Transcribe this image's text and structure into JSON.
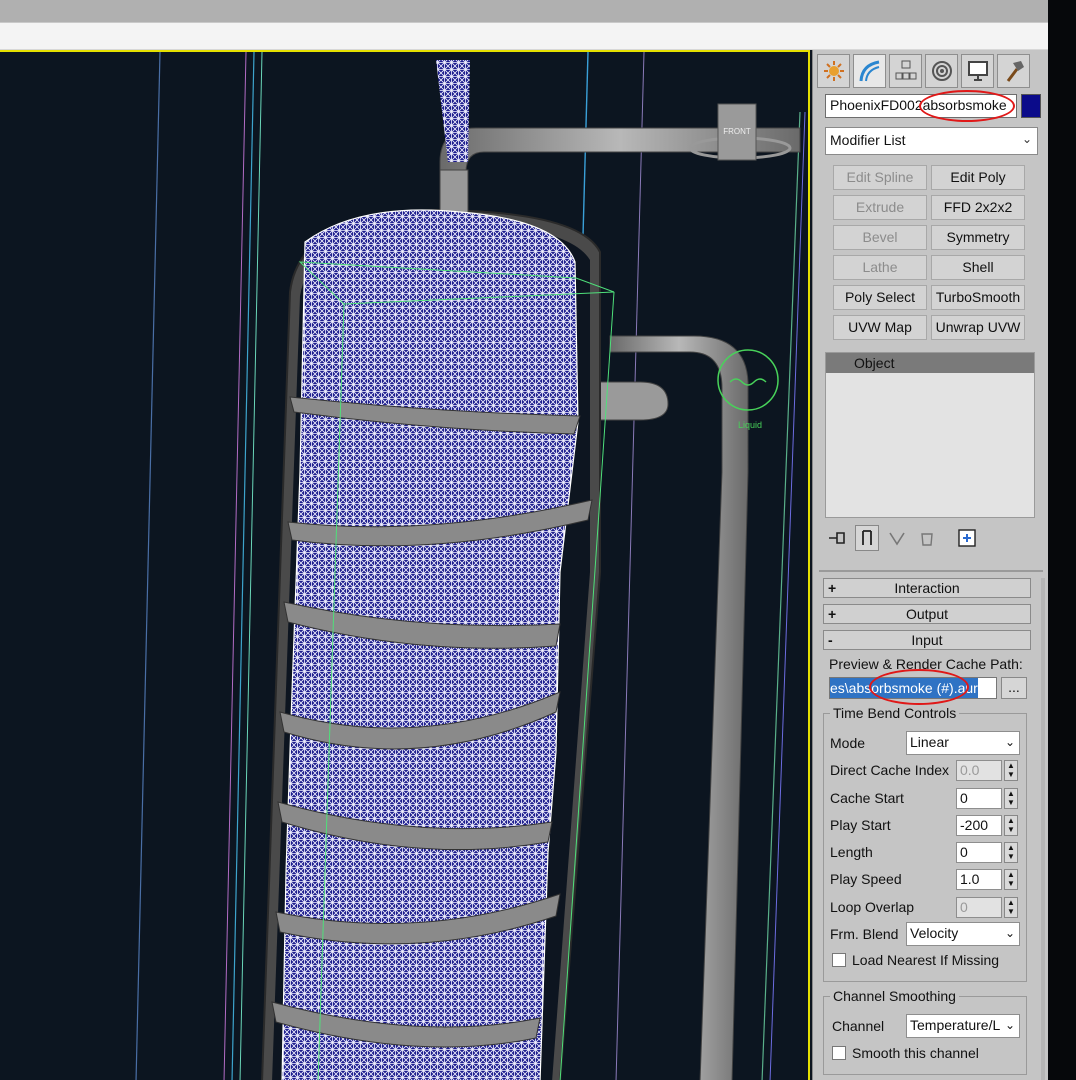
{
  "command_panel": {
    "tabs": [
      {
        "name": "create-tab",
        "icon": "sun-star-icon"
      },
      {
        "name": "modify-tab",
        "icon": "modify-curve-icon"
      },
      {
        "name": "hierarchy-tab",
        "icon": "hierarchy-icon"
      },
      {
        "name": "motion-tab",
        "icon": "motion-icon"
      },
      {
        "name": "display-tab",
        "icon": "display-monitor-icon"
      },
      {
        "name": "utilities-tab",
        "icon": "hammer-icon"
      }
    ],
    "object_name": "PhoenixFD002absorbsmoke",
    "object_color": "#0b0b8a",
    "modifier_list": "Modifier List",
    "modifier_buttons": [
      {
        "label": "Edit Spline",
        "enabled": false
      },
      {
        "label": "Edit Poly",
        "enabled": true
      },
      {
        "label": "Extrude",
        "enabled": false
      },
      {
        "label": "FFD 2x2x2",
        "enabled": true
      },
      {
        "label": "Bevel",
        "enabled": false
      },
      {
        "label": "Symmetry",
        "enabled": true
      },
      {
        "label": "Lathe",
        "enabled": false
      },
      {
        "label": "Shell",
        "enabled": true
      },
      {
        "label": "Poly Select",
        "enabled": true
      },
      {
        "label": "TurboSmooth",
        "enabled": true
      },
      {
        "label": "UVW Map",
        "enabled": true
      },
      {
        "label": "Unwrap UVW",
        "enabled": true
      }
    ],
    "stack_item": "Object",
    "stack_tools": [
      "pin-stack-icon",
      "show-end-result-icon",
      "make-unique-icon",
      "remove-modifier-icon",
      "configure-sets-icon"
    ]
  },
  "rollouts": {
    "interaction": {
      "sign": "+",
      "label": "Interaction"
    },
    "output": {
      "sign": "+",
      "label": "Output"
    },
    "input": {
      "sign": "-",
      "label": "Input"
    },
    "cache_path_label": "Preview & Render Cache Path:",
    "cache_path_value": "es\\absorbsmoke (#).aur",
    "browse_label": "...",
    "time_bend": {
      "title": "Time Bend Controls",
      "mode_label": "Mode",
      "mode_value": "Linear",
      "direct_cache_index_label": "Direct Cache Index",
      "direct_cache_index_value": "0.0",
      "cache_start_label": "Cache Start",
      "cache_start_value": "0",
      "play_start_label": "Play Start",
      "play_start_value": "-200",
      "length_label": "Length",
      "length_value": "0",
      "play_speed_label": "Play Speed",
      "play_speed_value": "1.0",
      "loop_overlap_label": "Loop Overlap",
      "loop_overlap_value": "0",
      "frm_blend_label": "Frm. Blend",
      "frm_blend_value": "Velocity",
      "load_nearest_label": "Load Nearest If Missing"
    },
    "channel_smoothing": {
      "title": "Channel Smoothing",
      "channel_label": "Channel",
      "channel_value": "Temperature/L",
      "smooth_label": "Smooth this channel"
    }
  },
  "viewport": {
    "front_label": "FRONT",
    "liquid_label": "Liquid"
  }
}
